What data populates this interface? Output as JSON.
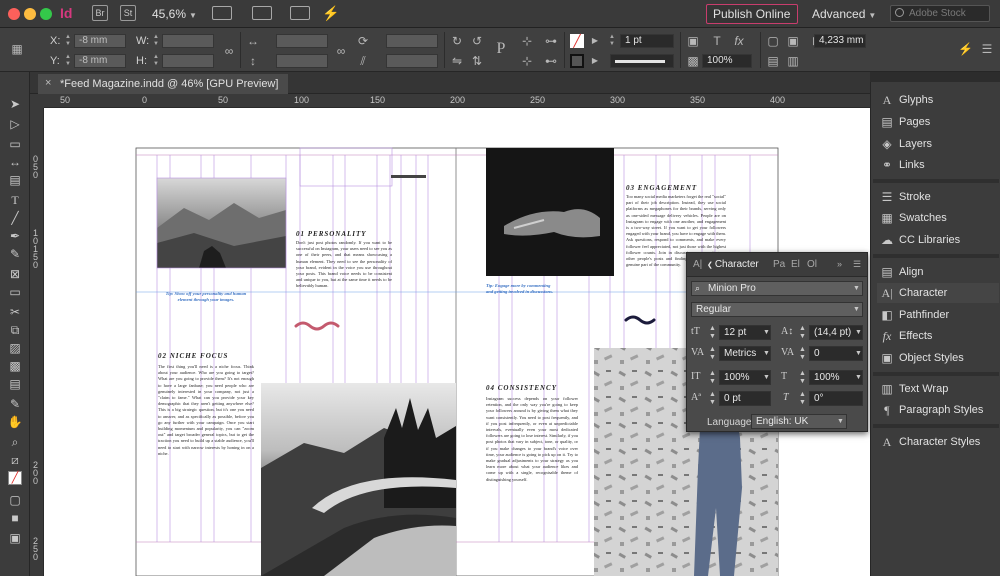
{
  "app": {
    "logo": "Id",
    "zoom": "45,6%",
    "publish_label": "Publish Online",
    "workspace": "Advanced",
    "stock_placeholder": "Adobe Stock"
  },
  "control": {
    "x_label": "X:",
    "y_label": "Y:",
    "x_value": "-8 mm",
    "y_value": "-8 mm",
    "w_label": "W:",
    "h_label": "H:",
    "w_value": "",
    "h_value": "",
    "stroke_weight": "1 pt",
    "opacity": "100%",
    "gutter": "4,233 mm"
  },
  "document": {
    "tab_title": "*Feed Magazine.indd @ 46% [GPU Preview]"
  },
  "rulers": {
    "h_ticks": [
      "50",
      "0",
      "50",
      "100",
      "150",
      "200",
      "250",
      "300",
      "350",
      "400"
    ],
    "v_ticks": [
      "0",
      "5",
      "0",
      "1",
      "0",
      "1",
      "5",
      "0",
      "2",
      "0",
      "0",
      "2",
      "5",
      "0"
    ]
  },
  "spread": {
    "personality_heading": "01 PERSONALITY",
    "personality_body": "Don't just post photos randomly. If you want to be successful on Instagram, your users need to see you as one of their peers, and that means showcasing a human element. They need to see the personality of your brand, evident in the voice you use throughout your posts. This brand voice needs to be consistent and unique to you, but at the same time it needs to be believably human.",
    "niche_heading": "02 NICHE FOCUS",
    "niche_body": "The first thing you'll need is a niche focus. Think about your audience. Who are you going to target? What are you going to provide them? It's not enough to have a large fanbase; you need people who are genuinely interested in your company, not just a \"claim to fame.\" What can you provide your key demographic that they aren't getting anywhere else? This is a big strategic question, but it's one you need to answer, and as specifically as possible, before you go any further with your campaign. Once you start building momentum and popularity, you can \"zoom out\" and target broader general topics, but to get the traction you need to build up a stable audience, you'll need to start with narrow interests by honing in on a niche.",
    "tip_left": "Tip: Show off your personality and human element through your images.",
    "consistency_heading": "04 CONSISTENCY",
    "consistency_body": "Instagram success depends on your follower retention, and the only way you're going to keep your followers around is by giving them what they want consistently. You need to post frequently, and if you post infrequently, or even at unpredictable intervals, eventually even your most dedicated followers are going to lose interest. Similarly, if you post photos that vary in subject, tone, or quality, or if you make changes to your brand's voice over time, your audience is going to pick up on it. Try to make gradual adjustments to your strategy as you learn more about what your audience likes and come up with a single, recognisable theme of distinguishing yourself.",
    "tip_right": "Tip: Engage more by commenting and getting involved in discussions.",
    "engagement_heading": "03 ENGAGEMENT",
    "engagement_body": "Too many social media marketers forget the real \"social\" part of their job description. Instead, they use social platforms as megaphones for their brands, serving only as one-sided message delivery vehicles. People are on Instagram to engage with one another, and engagement is a two-way street. If you want to get your followers engaged with your brand, you have to engage with them. Ask questions, respond to comments, and make every follower feel appreciated, not just those with the highest follower counts. Join in discussions commenting on other people's posts and finding new ways to be a genuine part of the community."
  },
  "character_panel": {
    "tabs": [
      "A|",
      "Character",
      "Pa",
      "El",
      "Ol"
    ],
    "font_family": "Minion Pro",
    "font_style": "Regular",
    "size": "12 pt",
    "leading": "(14,4 pt)",
    "kerning": "Metrics",
    "tracking": "0",
    "v_scale": "100%",
    "h_scale": "100%",
    "baseline": "0 pt",
    "skew": "0°",
    "language_label": "Language:",
    "language": "English: UK"
  },
  "dock": {
    "group1": [
      "Glyphs",
      "Pages",
      "Layers",
      "Links"
    ],
    "group2": [
      "Stroke",
      "Swatches",
      "CC Libraries"
    ],
    "group3": [
      "Align",
      "Character",
      "Pathfinder",
      "Effects",
      "Object Styles"
    ],
    "group4": [
      "Text Wrap",
      "Paragraph Styles"
    ],
    "group5": [
      "Character Styles"
    ]
  },
  "colors": {
    "accent": "#c83d6d",
    "guide": "#b892e0",
    "tip_blue": "#3b73c4",
    "wave": "#c45a6e"
  }
}
